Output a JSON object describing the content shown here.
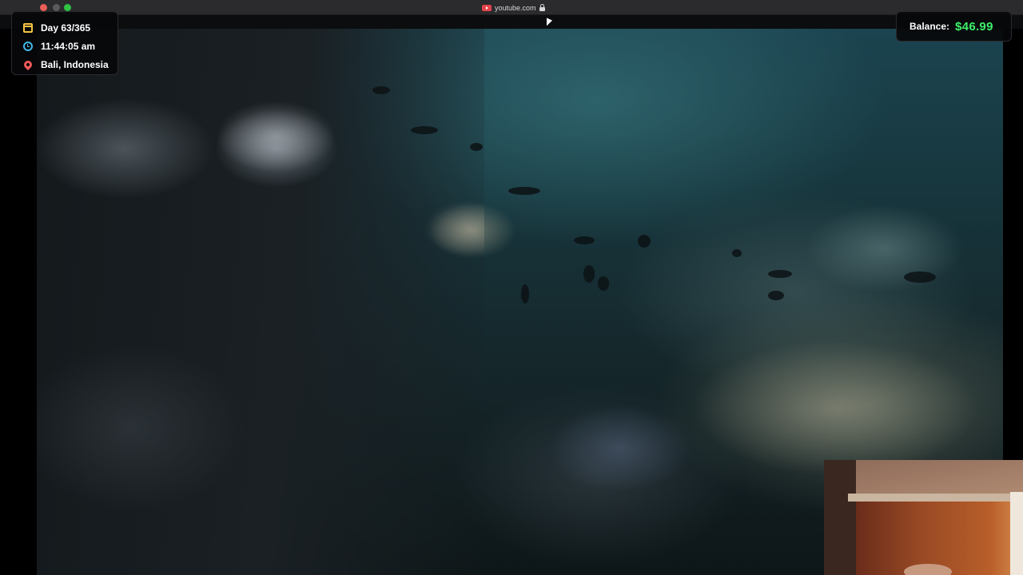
{
  "browser": {
    "url": "youtube.com",
    "site_icon": "youtube-icon",
    "secure_icon": "lock-icon"
  },
  "stream_info": {
    "day": "Day 63/365",
    "time": "11:44:05 am",
    "location": "Bali, Indonesia",
    "icons": [
      "calendar-icon",
      "clock-icon",
      "location-pin-icon"
    ]
  },
  "balance": {
    "label": "Balance:",
    "value": "$46.99",
    "color": "#3df06a"
  },
  "video": {
    "description_icon": "underwater-reef-video"
  }
}
